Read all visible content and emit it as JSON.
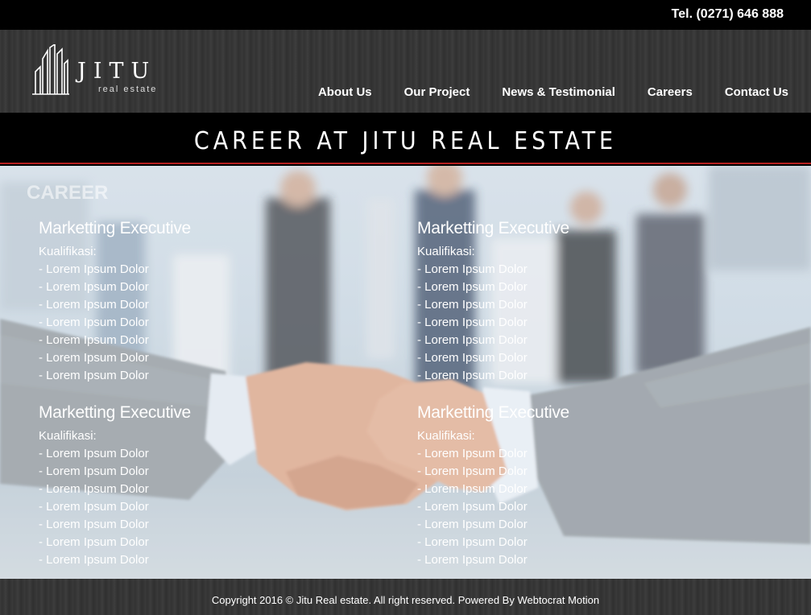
{
  "topbar": {
    "phone": "Tel. (0271) 646 888"
  },
  "logo": {
    "title": "JITU",
    "subtitle": "real estate",
    "icon": "building-logo"
  },
  "nav": [
    {
      "label": "About Us"
    },
    {
      "label": "Our Project"
    },
    {
      "label": "News & Testimonial"
    },
    {
      "label": "Careers"
    },
    {
      "label": "Contact Us"
    }
  ],
  "banner": {
    "title": "CAREER AT JITU REAL ESTATE"
  },
  "careers": {
    "heading": "CAREER",
    "jobs": [
      {
        "title": "Marketting Executive",
        "label": "Kualifikasi:",
        "items": [
          "- Lorem Ipsum Dolor",
          "- Lorem Ipsum Dolor",
          "- Lorem Ipsum Dolor",
          "- Lorem Ipsum Dolor",
          "- Lorem Ipsum Dolor",
          "- Lorem Ipsum Dolor",
          "- Lorem Ipsum Dolor"
        ]
      },
      {
        "title": "Marketting Executive",
        "label": "Kualifikasi:",
        "items": [
          "- Lorem Ipsum Dolor",
          "- Lorem Ipsum Dolor",
          "- Lorem Ipsum Dolor",
          "- Lorem Ipsum Dolor",
          "- Lorem Ipsum Dolor",
          "- Lorem Ipsum Dolor",
          "- Lorem Ipsum Dolor"
        ]
      },
      {
        "title": "Marketting Executive",
        "label": "Kualifikasi:",
        "items": [
          "- Lorem Ipsum Dolor",
          "- Lorem Ipsum Dolor",
          "- Lorem Ipsum Dolor",
          "- Lorem Ipsum Dolor",
          "- Lorem Ipsum Dolor",
          "- Lorem Ipsum Dolor",
          "- Lorem Ipsum Dolor"
        ]
      },
      {
        "title": "Marketting Executive",
        "label": "Kualifikasi:",
        "items": [
          "- Lorem Ipsum Dolor",
          "- Lorem Ipsum Dolor",
          "- Lorem Ipsum Dolor",
          "- Lorem Ipsum Dolor",
          "- Lorem Ipsum Dolor",
          "- Lorem Ipsum Dolor",
          "- Lorem Ipsum Dolor"
        ]
      }
    ]
  },
  "footer": {
    "text": "Copyright 2016 © Jitu Real estate. All right reserved. Powered By Webtocrat Motion"
  },
  "colors": {
    "accent_line": "#b52020",
    "header_bg": "#363636",
    "band_bg": "#000000"
  }
}
